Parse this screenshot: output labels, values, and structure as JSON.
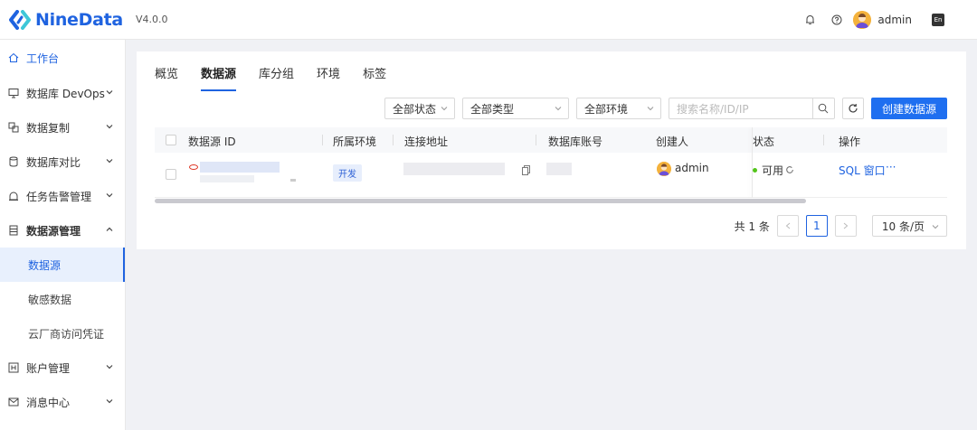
{
  "app": {
    "brand": "NineData",
    "version": "V4.0.0"
  },
  "topbar": {
    "user_name": "admin",
    "lang_label": "En"
  },
  "sidebar": {
    "items": [
      {
        "label": "工作台",
        "icon": "home-icon"
      },
      {
        "label": "数据库 DevOps",
        "icon": "devops-icon"
      },
      {
        "label": "数据复制",
        "icon": "replicate-icon"
      },
      {
        "label": "数据库对比",
        "icon": "compare-icon"
      },
      {
        "label": "任务告警管理",
        "icon": "alarm-icon"
      },
      {
        "label": "数据源管理",
        "icon": "datasource-icon"
      },
      {
        "label": "账户管理",
        "icon": "account-icon"
      },
      {
        "label": "消息中心",
        "icon": "message-icon"
      }
    ],
    "sub_items": [
      {
        "label": "数据源"
      },
      {
        "label": "敏感数据"
      },
      {
        "label": "云厂商访问凭证"
      }
    ]
  },
  "tabs": [
    {
      "label": "概览"
    },
    {
      "label": "数据源"
    },
    {
      "label": "库分组"
    },
    {
      "label": "环境"
    },
    {
      "label": "标签"
    }
  ],
  "filters": {
    "status": "全部状态",
    "type": "全部类型",
    "env": "全部环境",
    "search_placeholder": "搜索名称/ID/IP",
    "create_label": "创建数据源"
  },
  "table": {
    "headers": {
      "id": "数据源 ID",
      "env": "所属环境",
      "address": "连接地址",
      "account": "数据库账号",
      "creator": "创建人",
      "status": "状态",
      "actions": "操作"
    },
    "rows": [
      {
        "env": "开发",
        "creator": "admin",
        "status": "可用",
        "action_sql": "SQL 窗口",
        "action_more": "···"
      }
    ]
  },
  "pagination": {
    "total": "共 1 条",
    "current_page": "1",
    "page_size": "10 条/页"
  },
  "colors": {
    "brand": "#1f63e0",
    "accent_button": "#1f6ff0",
    "status_ok": "#52c41a"
  }
}
